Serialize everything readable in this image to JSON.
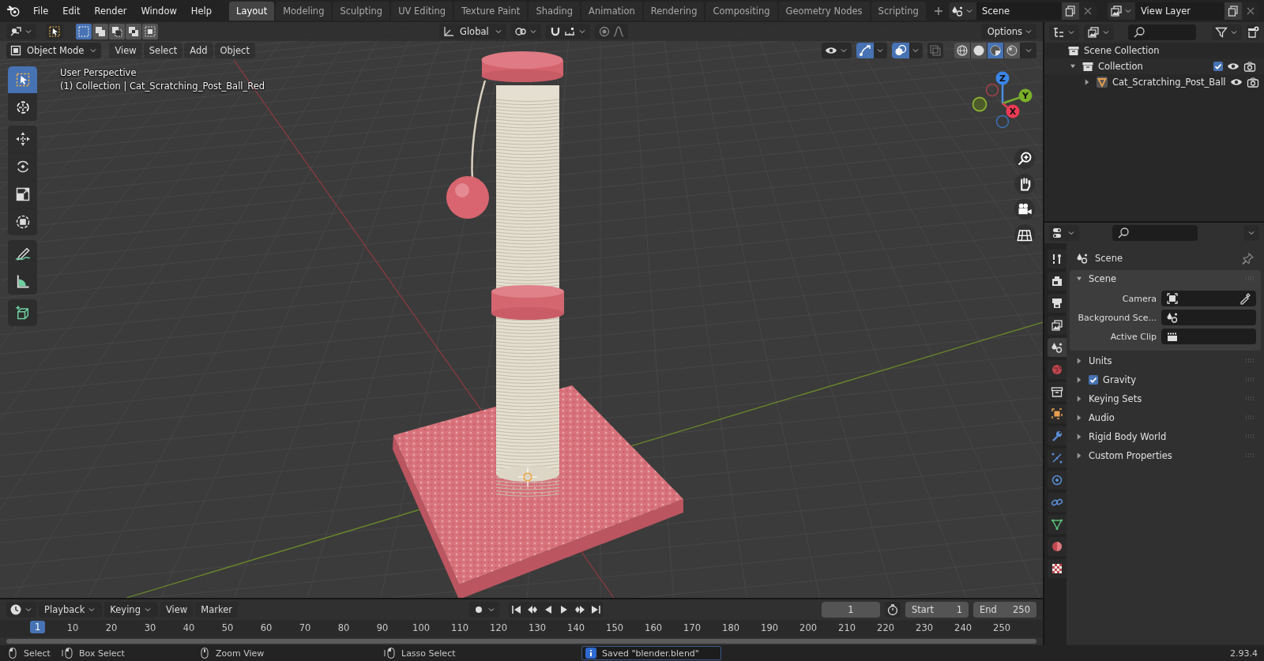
{
  "menu": [
    "File",
    "Edit",
    "Render",
    "Window",
    "Help"
  ],
  "workspace_tabs": [
    {
      "label": "Layout",
      "selected": true
    },
    {
      "label": "Modeling",
      "selected": false
    },
    {
      "label": "Sculpting",
      "selected": false
    },
    {
      "label": "UV Editing",
      "selected": false
    },
    {
      "label": "Texture Paint",
      "selected": false
    },
    {
      "label": "Shading",
      "selected": false
    },
    {
      "label": "Animation",
      "selected": false
    },
    {
      "label": "Rendering",
      "selected": false
    },
    {
      "label": "Compositing",
      "selected": false
    },
    {
      "label": "Geometry Nodes",
      "selected": false
    },
    {
      "label": "Scripting",
      "selected": false
    }
  ],
  "scene_selector": {
    "value": "Scene"
  },
  "view_layer_selector": {
    "value": "View Layer"
  },
  "viewport": {
    "select_modes": [
      {
        "kind": "new",
        "selected": true
      },
      {
        "kind": "extend",
        "selected": false
      },
      {
        "kind": "subtract",
        "selected": false
      },
      {
        "kind": "difference",
        "selected": false
      },
      {
        "kind": "intersect",
        "selected": false
      }
    ],
    "transform_orientation": "Global",
    "options": "Options",
    "mode": "Object Mode",
    "menus": [
      "View",
      "Select",
      "Add",
      "Object"
    ],
    "shading": [
      {
        "kind": "wireframe",
        "selected": false
      },
      {
        "kind": "solid",
        "selected": false
      },
      {
        "kind": "material",
        "selected": true
      },
      {
        "kind": "rendered",
        "selected": false
      }
    ],
    "overlay_text": [
      "User Perspective",
      "(1) Collection | Cat_Scratching_Post_Ball_Red"
    ],
    "tool_groups": [
      [
        {
          "kind": "select_box",
          "selected": true
        },
        {
          "kind": "cursor",
          "selected": false
        }
      ],
      [
        {
          "kind": "move",
          "selected": false
        },
        {
          "kind": "rotate",
          "selected": false
        },
        {
          "kind": "scale",
          "selected": false
        },
        {
          "kind": "transform",
          "selected": false
        }
      ],
      [
        {
          "kind": "annotate",
          "selected": false
        },
        {
          "kind": "measure",
          "selected": false
        }
      ],
      [
        {
          "kind": "add_cube",
          "selected": false
        }
      ]
    ],
    "gizmo_axes": [
      "Z",
      "Y",
      "X"
    ]
  },
  "outliner": {
    "items": [
      {
        "label": "Scene Collection",
        "kind": "collection",
        "children": [
          {
            "label": "Collection",
            "kind": "collection",
            "expanded": true,
            "checked": true,
            "children": [
              {
                "label": "Cat_Scratching_Post_Ball",
                "kind": "mesh",
                "expanded": false
              }
            ]
          }
        ]
      }
    ]
  },
  "properties": {
    "tabs": [
      {
        "kind": "tool",
        "selected": false
      },
      {
        "kind": "render",
        "selected": false
      },
      {
        "kind": "output",
        "selected": false
      },
      {
        "kind": "view_layer",
        "selected": false
      },
      {
        "kind": "scene",
        "selected": true
      },
      {
        "kind": "world",
        "selected": false
      },
      {
        "kind": "collection",
        "selected": false
      },
      {
        "kind": "object",
        "selected": false
      },
      {
        "kind": "modifiers",
        "selected": false
      },
      {
        "kind": "particles",
        "selected": false
      },
      {
        "kind": "physics",
        "selected": false
      },
      {
        "kind": "constraints",
        "selected": false
      },
      {
        "kind": "data",
        "selected": false
      },
      {
        "kind": "material",
        "selected": false
      },
      {
        "kind": "texture",
        "selected": false
      }
    ],
    "context": "Scene",
    "panels": [
      {
        "label": "Scene",
        "expanded": true,
        "fields": [
          {
            "label": "Camera",
            "kind": "camera"
          },
          {
            "label": "Background Sce...",
            "kind": "scene"
          },
          {
            "label": "Active Clip",
            "kind": "clip"
          }
        ]
      },
      {
        "label": "Units",
        "expanded": false
      },
      {
        "label": "Gravity",
        "expanded": false,
        "checked": true
      },
      {
        "label": "Keying Sets",
        "expanded": false
      },
      {
        "label": "Audio",
        "expanded": false
      },
      {
        "label": "Rigid Body World",
        "expanded": false
      },
      {
        "label": "Custom Properties",
        "expanded": false
      }
    ]
  },
  "timeline": {
    "menus": [
      {
        "label": "Playback",
        "kind": "dropdown"
      },
      {
        "label": "Keying",
        "kind": "dropdown"
      },
      {
        "label": "View",
        "kind": "menu"
      },
      {
        "label": "Marker",
        "kind": "menu"
      }
    ],
    "current_frame": "1",
    "start_label": "Start",
    "start": "1",
    "end_label": "End",
    "end": "250",
    "playhead": "1",
    "ticks": [
      "10",
      "20",
      "30",
      "40",
      "50",
      "60",
      "70",
      "80",
      "90",
      "100",
      "110",
      "120",
      "130",
      "140",
      "150",
      "160",
      "170",
      "180",
      "190",
      "200",
      "210",
      "220",
      "230",
      "240",
      "250"
    ]
  },
  "status_bar": {
    "items": [
      {
        "kind": "left",
        "label": "Select"
      },
      {
        "kind": "drag",
        "label": "Box Select"
      },
      {
        "kind": "middle",
        "label": "Zoom View"
      },
      {
        "kind": "drag",
        "label": "Lasso Select"
      }
    ],
    "message": "Saved \"blender.blend\"",
    "version": "2.93.4"
  }
}
